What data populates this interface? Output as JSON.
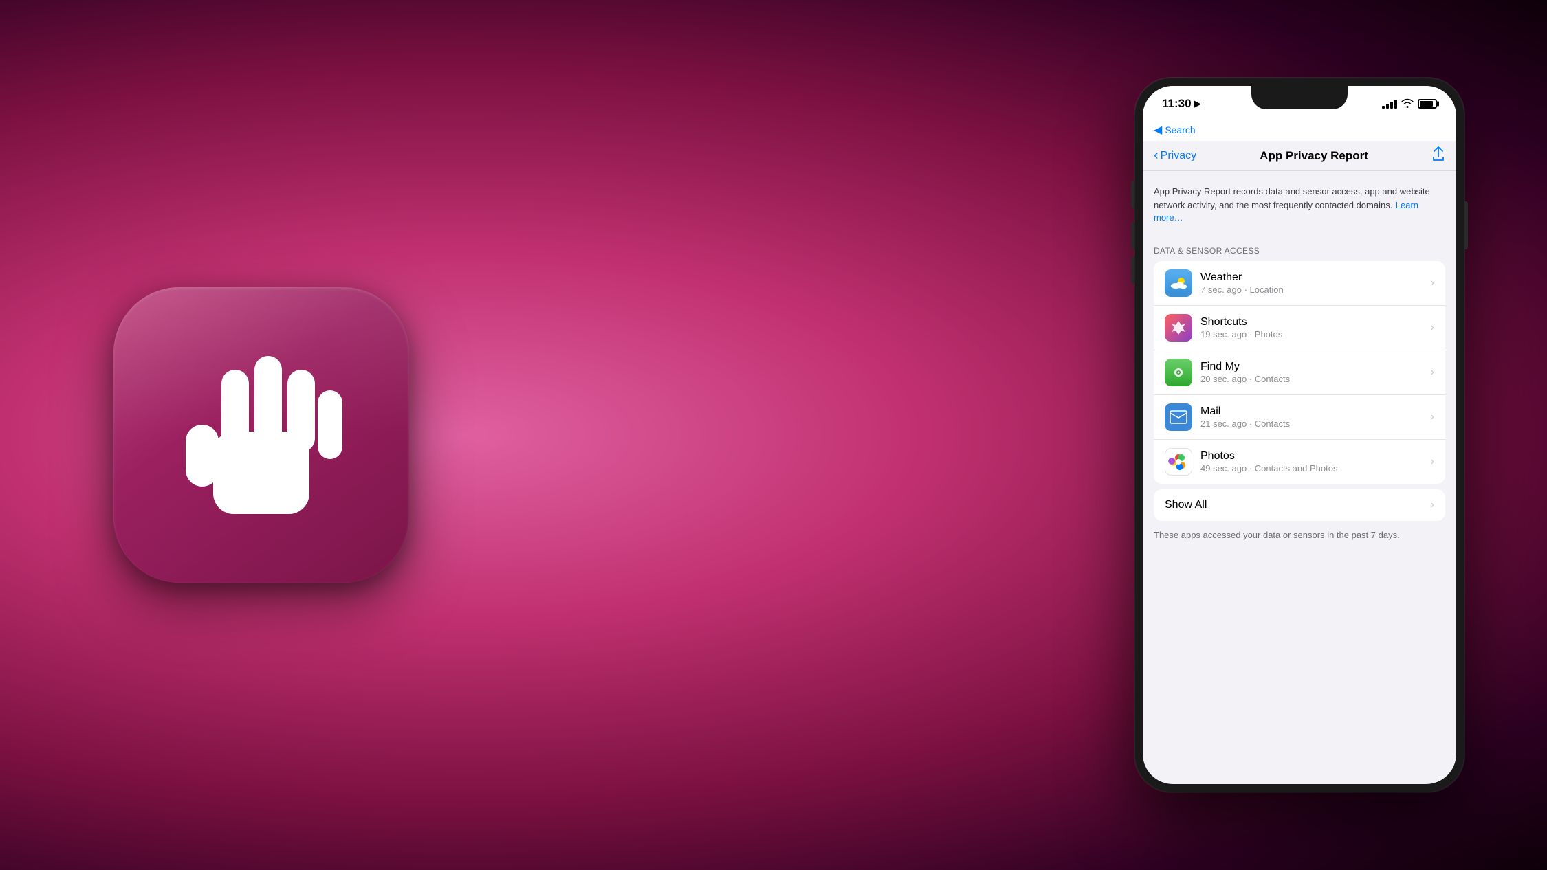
{
  "background": {
    "colors": {
      "primary": "#c03070",
      "dark": "#1a0010",
      "gradient_stop1": "#e060a0",
      "gradient_stop2": "#c03070",
      "gradient_stop3": "#7a1040",
      "gradient_stop4": "#2a0020"
    }
  },
  "app_icon": {
    "alt": "App Privacy Report app icon with hand symbol"
  },
  "status_bar": {
    "time": "11:30",
    "location_arrow": "▶",
    "search_back": "Search"
  },
  "navigation": {
    "back_label": "Privacy",
    "page_title": "App Privacy Report",
    "share_icon": "share"
  },
  "description": {
    "text": "App Privacy Report records data and sensor access, app and website network activity, and the most frequently contacted domains.",
    "learn_more": "Learn more…"
  },
  "section_header": "DATA & SENSOR ACCESS",
  "apps": [
    {
      "name": "Weather",
      "detail": "7 sec. ago · Location",
      "icon_type": "weather"
    },
    {
      "name": "Shortcuts",
      "detail": "19 sec. ago · Photos",
      "icon_type": "shortcuts"
    },
    {
      "name": "Find My",
      "detail": "20 sec. ago · Contacts",
      "icon_type": "findmy"
    },
    {
      "name": "Mail",
      "detail": "21 sec. ago · Contacts",
      "icon_type": "mail"
    },
    {
      "name": "Photos",
      "detail": "49 sec. ago · Contacts and Photos",
      "icon_type": "photos"
    }
  ],
  "show_all": "Show All",
  "footer_text": "These apps accessed your data or sensors in the past 7 days."
}
